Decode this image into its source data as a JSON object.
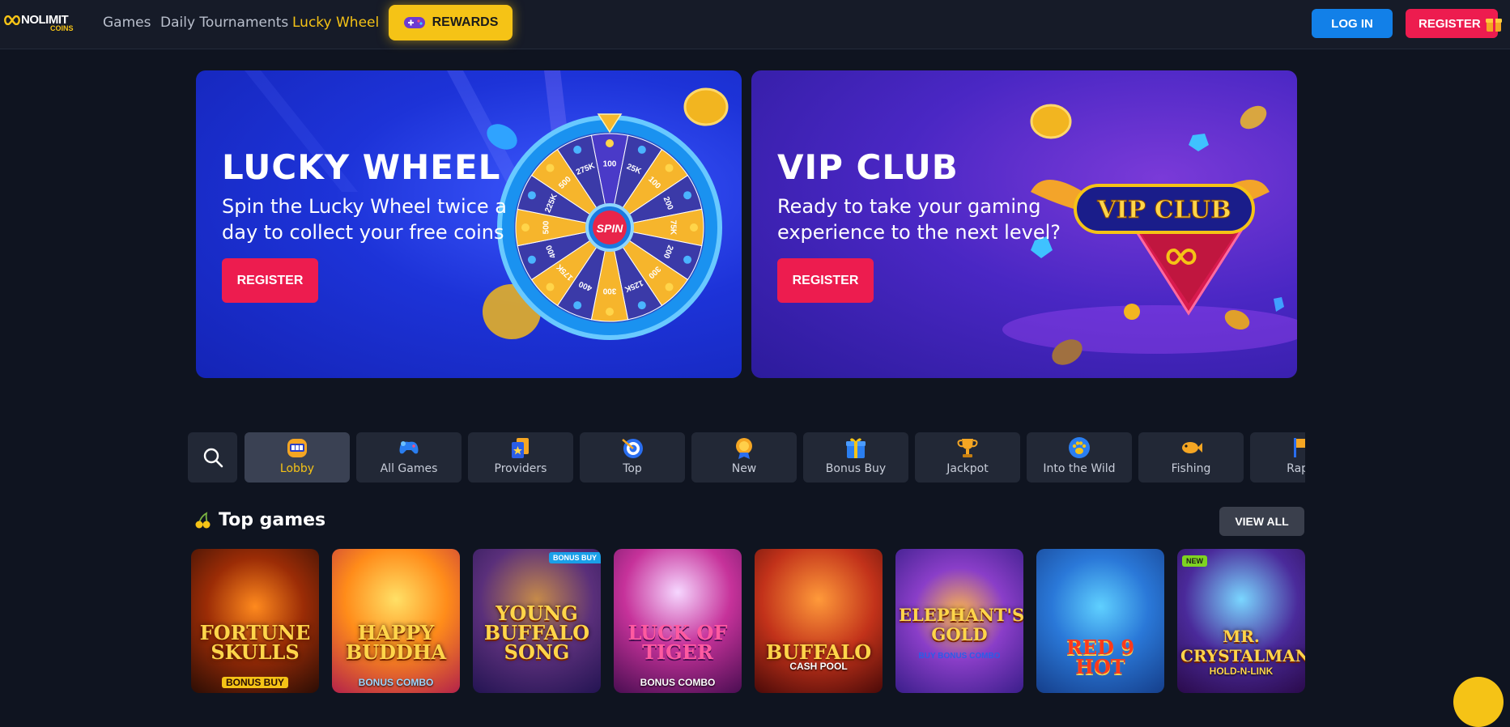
{
  "header": {
    "logo_brand": "NOLIMIT",
    "logo_sub": "COINS",
    "nav": [
      {
        "label": "Games"
      },
      {
        "label": "Daily Tournaments"
      },
      {
        "label": "Lucky Wheel"
      }
    ],
    "rewards_label": "REWARDS",
    "login_label": "LOG IN",
    "register_label": "REGISTER"
  },
  "banners": {
    "lucky": {
      "title": "LUCKY WHEEL",
      "text": "Spin the Lucky Wheel twice a day to collect your free coins",
      "button": "REGISTER",
      "wheel_center": "SPIN",
      "wheel_values": [
        "100",
        "25K",
        "100",
        "200",
        "75K",
        "200",
        "300",
        "125K",
        "300",
        "400",
        "175K",
        "400",
        "500",
        "225K",
        "500",
        "275K"
      ]
    },
    "vip": {
      "title": "VIP CLUB",
      "text": "Ready to take your gaming experience to the next level?",
      "button": "REGISTER",
      "badge_text": "VIP CLUB"
    }
  },
  "categories": [
    {
      "label": "Lobby",
      "icon": "slot-machine-icon"
    },
    {
      "label": "All Games",
      "icon": "gamepad-icon"
    },
    {
      "label": "Providers",
      "icon": "cards-icon"
    },
    {
      "label": "Top",
      "icon": "target-icon"
    },
    {
      "label": "New",
      "icon": "medal-icon"
    },
    {
      "label": "Bonus Buy",
      "icon": "gift-icon"
    },
    {
      "label": "Jackpot",
      "icon": "trophy-icon"
    },
    {
      "label": "Into the Wild",
      "icon": "paw-icon"
    },
    {
      "label": "Fishing",
      "icon": "fish-icon"
    },
    {
      "label": "Rapid",
      "icon": "flag-icon"
    }
  ],
  "top_games": {
    "title": "Top games",
    "view_all": "VIEW ALL",
    "games": [
      {
        "title": "FORTUNE SKULLS",
        "sub": "BONUS BUY",
        "badge": ""
      },
      {
        "title": "HAPPY BUDDHA",
        "sub": "BONUS COMBO",
        "badge": ""
      },
      {
        "title": "YOUNG BUFFALO SONG",
        "sub": "",
        "badge": "BONUS BUY"
      },
      {
        "title": "LUCK OF TIGER",
        "sub": "BONUS COMBO",
        "badge": ""
      },
      {
        "title": "BUFFALO",
        "sub": "CASH POOL",
        "badge": ""
      },
      {
        "title": "ELEPHANT'S GOLD",
        "sub": "BUY BONUS COMBO",
        "badge": ""
      },
      {
        "title": "RED 9 HOT",
        "sub": "",
        "badge": ""
      },
      {
        "title": "MR. CRYSTALMAN",
        "sub": "HOLD-N-LINK",
        "badge": "NEW"
      }
    ]
  },
  "colors": {
    "accent": "#f5c316",
    "primary_blue": "#1280e8",
    "register_red": "#ed1c4f",
    "background": "#0f1420"
  }
}
